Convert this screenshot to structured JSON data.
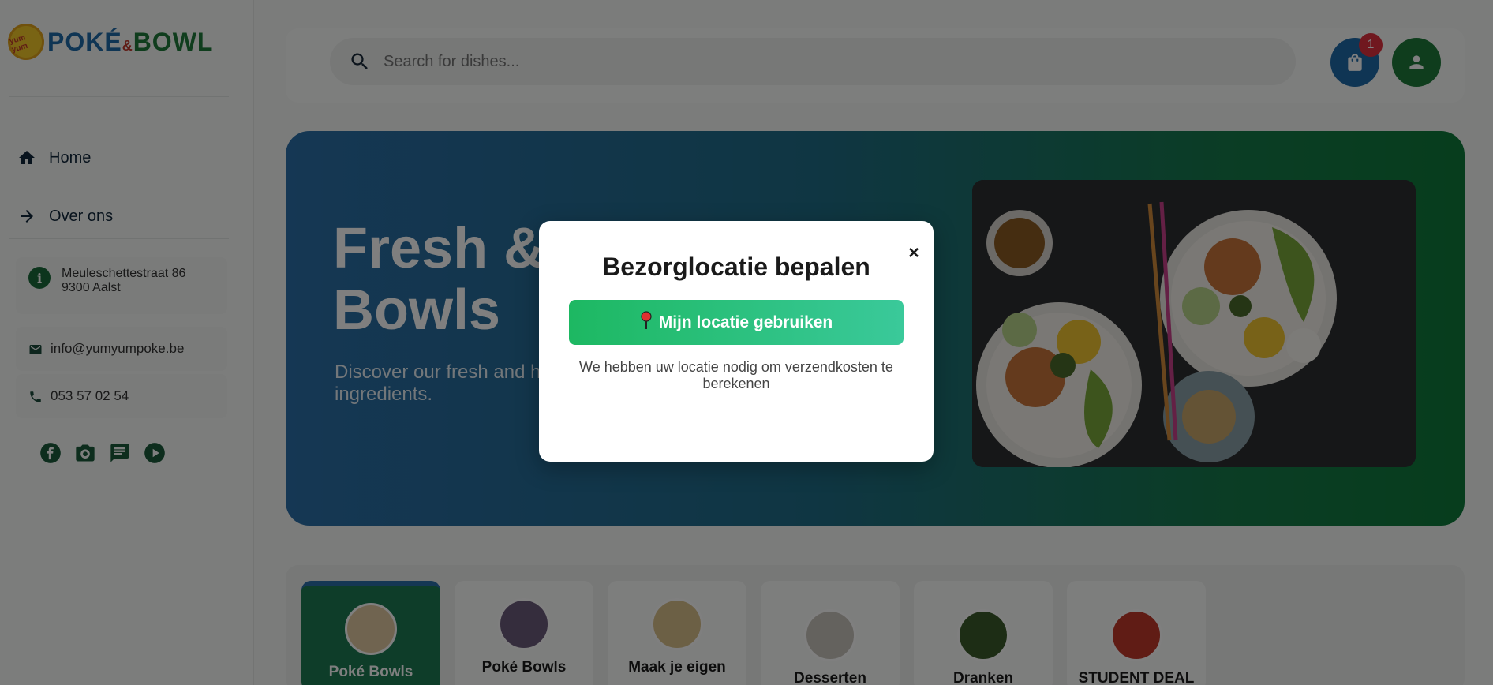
{
  "sidebar": {
    "logo": {
      "badge": "yum yum",
      "part1": "POKÉ",
      "amp": "&",
      "part2": "BOWL"
    },
    "nav": [
      {
        "label": "Home",
        "icon": "home-icon"
      },
      {
        "label": "Over ons",
        "icon": "arrow-right-icon"
      }
    ],
    "contact": {
      "address_line1": "Meuleschettestraat 86",
      "address_line2": "9300 Aalst",
      "email": "info@yumyumpoke.be",
      "phone": "053 57 02 54"
    },
    "socials": [
      "facebook-icon",
      "camera-icon",
      "message-icon",
      "play-icon"
    ]
  },
  "search": {
    "placeholder": "Search for dishes..."
  },
  "cart": {
    "count": "1"
  },
  "hero": {
    "title_line1": "Fresh & C",
    "title_line2": "Bowls",
    "subtitle_line1": "Discover our fresh and hea",
    "subtitle_line2": "ingredients."
  },
  "categories": [
    {
      "label": "Poké Bowls",
      "active": true
    },
    {
      "label": "Poké Bowls",
      "active": false
    },
    {
      "label": "Maak je eigen",
      "active": false
    },
    {
      "label": "Desserten",
      "active": false
    },
    {
      "label": "Dranken",
      "active": false
    },
    {
      "label": "STUDENT DEAL",
      "active": false
    }
  ],
  "modal": {
    "title": "Bezorglocatie bepalen",
    "close": "×",
    "button_label": "Mijn locatie gebruiken",
    "note": "We hebben uw locatie nodig om verzendkosten te berekenen"
  },
  "colors": {
    "brand_blue": "#1e6aa8",
    "brand_green": "#1f7a3a",
    "badge_red": "#e0313e",
    "button_green": "#1db862"
  }
}
